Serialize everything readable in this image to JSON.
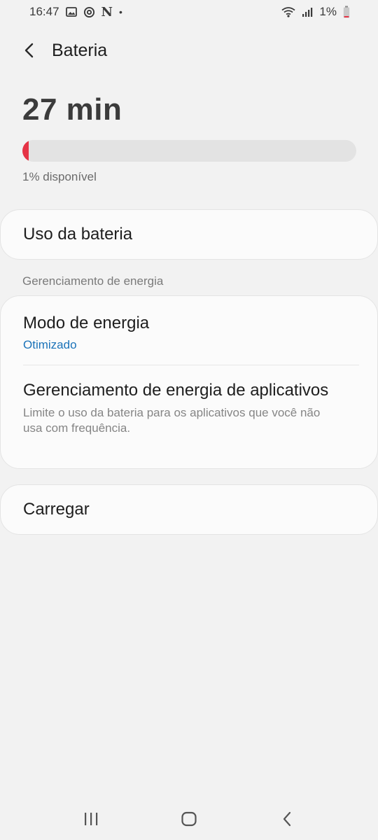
{
  "status_bar": {
    "time": "16:47",
    "n_label": "N",
    "dot": "•",
    "battery_percent": "1%",
    "icons": [
      "image-icon",
      "sync-icon",
      "wifi-icon",
      "signal-icon",
      "battery-icon"
    ]
  },
  "header": {
    "title": "Bateria",
    "back_icon": "chevron-left-icon"
  },
  "battery": {
    "remaining": "27 min",
    "level_fraction": 0.01,
    "available_text": "1% disponível",
    "fill_color": "#e53446"
  },
  "battery_usage": {
    "label": "Uso da bateria"
  },
  "power_management": {
    "section_title": "Gerenciamento de energia",
    "power_mode": {
      "title": "Modo de energia",
      "value": "Otimizado"
    },
    "app_power": {
      "title": "Gerenciamento de energia de aplicativos",
      "description": "Limite o uso da bateria para os aplicativos que você não usa com frequência."
    }
  },
  "charging": {
    "label": "Carregar"
  },
  "nav_bar": {
    "icons": [
      "recents-icon",
      "home-icon",
      "back-icon"
    ]
  },
  "colors": {
    "accent": "#1b73b9",
    "background": "#f2f2f2",
    "card": "#fbfbfb"
  }
}
